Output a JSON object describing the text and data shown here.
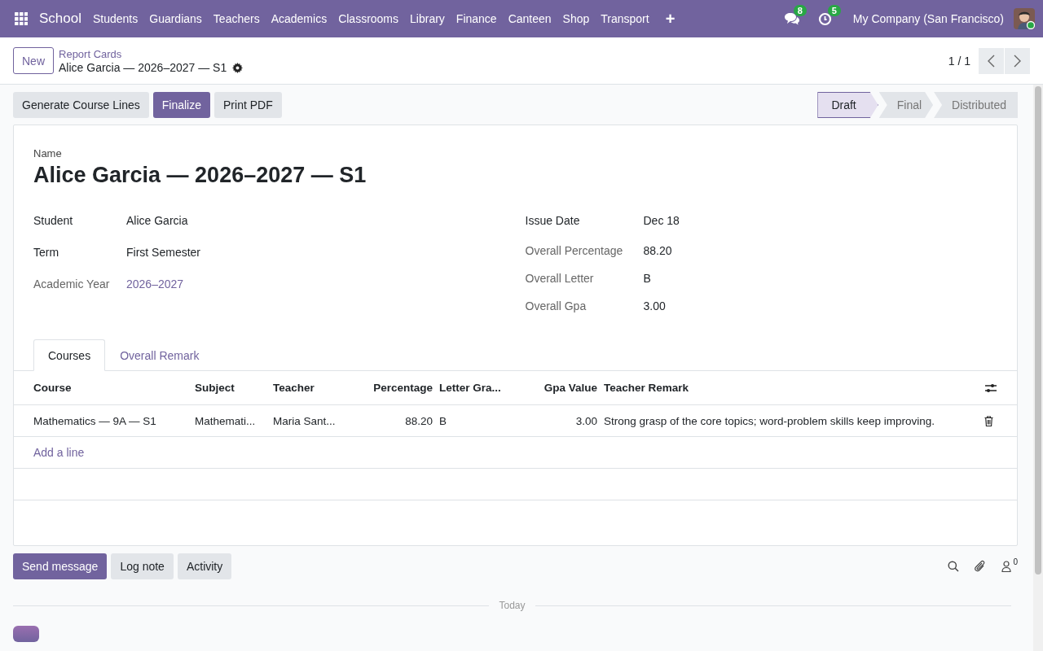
{
  "navbar": {
    "app": "School",
    "menu": [
      "Students",
      "Guardians",
      "Teachers",
      "Academics",
      "Classrooms",
      "Library",
      "Finance",
      "Canteen",
      "Shop",
      "Transport"
    ],
    "plus": "+",
    "messages_count": "8",
    "activities_count": "5",
    "company": "My Company (San Francisco)"
  },
  "control_panel": {
    "new_button": "New",
    "breadcrumb": "Report Cards",
    "record": "Alice Garcia — 2026–2027 — S1",
    "pager": "1 / 1"
  },
  "actions": [
    {
      "label": "Generate Course Lines",
      "primary": false
    },
    {
      "label": "Finalize",
      "primary": true
    },
    {
      "label": "Print PDF",
      "primary": false
    }
  ],
  "stages": [
    {
      "label": "Draft",
      "selected": true
    },
    {
      "label": "Final",
      "selected": false
    },
    {
      "label": "Distributed",
      "selected": false
    }
  ],
  "form": {
    "name_label": "Name",
    "name": "Alice Garcia — 2026–2027 — S1",
    "left_fields": [
      {
        "label": "Student",
        "value": "Alice Garcia",
        "required": true,
        "link": false
      },
      {
        "label": "Term",
        "value": "First Semester",
        "required": true,
        "link": false
      },
      {
        "label": "Academic Year",
        "value": "2026–2027",
        "required": false,
        "link": true
      }
    ],
    "right_fields": [
      {
        "label": "Issue Date",
        "value": "Dec 18",
        "required": true,
        "link": false
      },
      {
        "label": "Overall Percentage",
        "value": "88.20",
        "required": false,
        "link": false
      },
      {
        "label": "Overall Letter",
        "value": "B",
        "required": false,
        "link": false
      },
      {
        "label": "Overall Gpa",
        "value": "3.00",
        "required": false,
        "link": false
      }
    ]
  },
  "tabs": [
    {
      "label": "Courses",
      "selected": true
    },
    {
      "label": "Overall Remark",
      "selected": false
    }
  ],
  "table": {
    "columns": [
      "Course",
      "Subject",
      "Teacher",
      "Percentage",
      "Letter Gra...",
      "Gpa Value",
      "Teacher Remark"
    ],
    "rows": [
      [
        "Mathematics — 9A — S1",
        "Mathemati...",
        "Maria Sant...",
        "88.20",
        "B",
        "3.00",
        "Strong grasp of the core topics; word-problem skills keep improving."
      ]
    ],
    "add_line": "Add a line"
  },
  "chatter": {
    "buttons": [
      {
        "label": "Send message",
        "primary": true
      },
      {
        "label": "Log note",
        "primary": false
      },
      {
        "label": "Activity",
        "primary": false
      }
    ],
    "followers_count": "0",
    "divider": "Today"
  }
}
